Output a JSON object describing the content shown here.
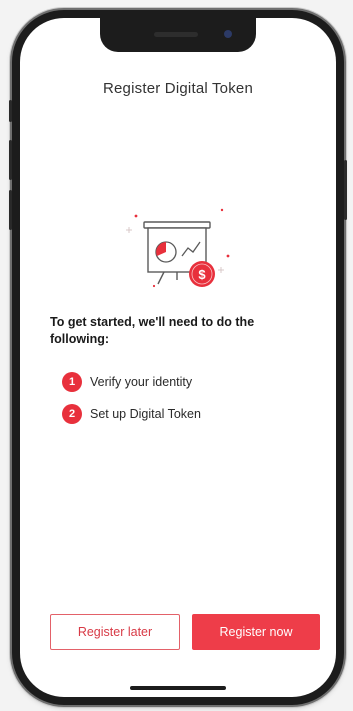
{
  "screen": {
    "title": "Register Digital Token",
    "intro_text": "To get started, we'll need to do the following:",
    "steps": [
      {
        "number": "1",
        "label": "Verify your identity"
      },
      {
        "number": "2",
        "label": "Set up Digital Token"
      }
    ],
    "buttons": {
      "later_label": "Register later",
      "now_label": "Register now"
    },
    "illustration_icon": "presentation-board-dollar-icon"
  },
  "colors": {
    "accent": "#ee3d49",
    "accent_border": "#e36169",
    "text_dark": "#1a1a1a",
    "phone_frame": "#1c1c1c"
  }
}
